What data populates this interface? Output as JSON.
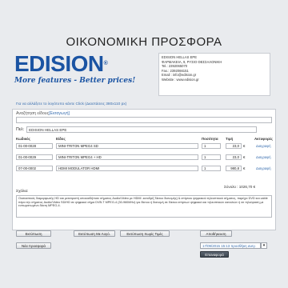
{
  "header": {
    "title": "ΟΙΚΟΝΟΜΙΚΗ ΠΡΟΣΦΟΡΑ"
  },
  "logo": {
    "word": "EDISION",
    "reg": "®",
    "slogan": "More features - Better prices!"
  },
  "company": {
    "lines": [
      "EDISION HELLAS EPE",
      "ΦΑΡΜΑΚΕΙΑ, 9, ΡΥΣΙΟ ΘΕΣΣΑΛΟΝΙΚΗ",
      "Tel.: 2392065070",
      "Fax.: 2392066151",
      "Email : info@edision.gr",
      "Website : www.edision.gr"
    ]
  },
  "logo_hint": "Για να αλλάξετε το λογότυπο κάντε Click (Διαστάσεις 380x110 px)",
  "search": {
    "label": "Αναζήτηση είδους",
    "link": "[Εισαγωγή]"
  },
  "customer": {
    "label": "Πελ:",
    "value": "EDISION HELLAS EPE"
  },
  "table": {
    "headers": {
      "code": "Κωδικός",
      "item": "Είδος",
      "qty": "Ποσότητα",
      "price": "Τιμή",
      "actions": "Ακτυφορές"
    },
    "rows": [
      {
        "code": "01-00-0028",
        "item": "MINI-TRITON MPEG4 SD",
        "qty": "1",
        "price": "23,0",
        "del": "Διαγραφή"
      },
      {
        "code": "01-00-0029",
        "item": "MINI-TRITON MPEG4 + HD",
        "qty": "1",
        "price": "23,0",
        "del": "Διαγραφή"
      },
      {
        "code": "07-00-0002",
        "item": "HDMI MODULATOR HDMI",
        "qty": "1",
        "price": "980,8",
        "del": "Διαγραφή"
      }
    ],
    "currency": "€",
    "total": "Σύνολο : 1026,70 €"
  },
  "notes": {
    "label": "Σχόλια:",
    "text": "Ουσιαστικός διαμορφωτής HD και μετατροπή οποιασδήποτε σήματος Audio/Video με HDMI -εισοδρίζ δίκτυο διανομής) & επίγειου ψηφιακού τηλεοπτικού σήματος, παρέχει DVD και cable πέρα την σήματος Audio/Video SD/HD σε ψηφιακό σήμα DVB-T MPEG-4 (30-960MHz) για δίκτυο ή διανομή σε δίκτυα επίγειων ψηφιακό και τηλεοπτικών καναλιών ή σε τηλεόραση με ενσωματωμένο δέκτη MPEG-4."
  },
  "buttons": {
    "print": "Εκτύπωση",
    "print_logo": "Εκτύπωση Με Λογό.",
    "print_no_prices": "Εκτύπωση Χωρίς Τιμές",
    "save": "Αποθήκευση",
    "new_offer": "Νέα προσφορά",
    "reload": "Επαναφορά"
  },
  "date": {
    "value": "17/09/2015 15:13 προσθήκη ανεγ.",
    "dropdown": "▾"
  }
}
